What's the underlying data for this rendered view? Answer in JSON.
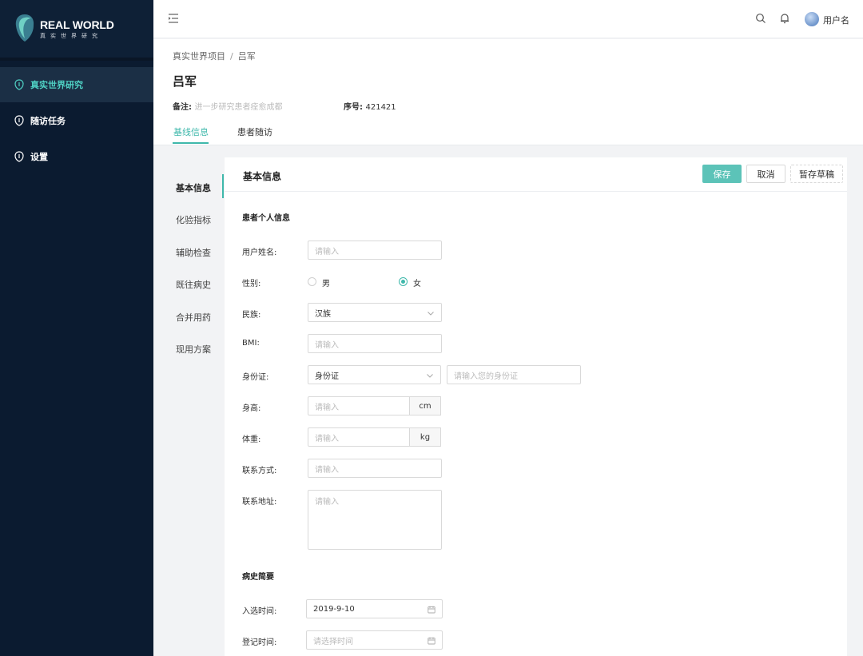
{
  "brand": {
    "title": "REAL WORLD",
    "subtitle": "真实世界研究"
  },
  "sidebar": {
    "items": [
      {
        "label": "真实世界研究",
        "active": true
      },
      {
        "label": "随访任务",
        "active": false
      },
      {
        "label": "设置",
        "active": false
      }
    ]
  },
  "topbar": {
    "username": "用户名"
  },
  "header": {
    "breadcrumb": [
      "真实世界项目",
      "吕军"
    ],
    "breadcrumb_sep": "/",
    "title": "吕军",
    "remark_label": "备注:",
    "remark_value": "进一步研究患者痊愈成都",
    "serial_label": "序号:",
    "serial_value": "421421",
    "tabs": [
      {
        "label": "基线信息",
        "active": true
      },
      {
        "label": "患者随访",
        "active": false
      }
    ]
  },
  "section_menu": [
    "基本信息",
    "化验指标",
    "辅助检查",
    "既往病史",
    "合并用药",
    "现用方案"
  ],
  "card": {
    "title": "基本信息",
    "buttons": {
      "save": "保存",
      "cancel": "取消",
      "draft": "暂存草稿"
    },
    "group_personal": "患者个人信息",
    "group_history": "病史简要",
    "fields": {
      "name": {
        "label": "用户姓名:",
        "placeholder": "请输入"
      },
      "gender": {
        "label": "性别:",
        "options": [
          "男",
          "女"
        ],
        "selected": "女"
      },
      "ethnicity": {
        "label": "民族:",
        "value": "汉族"
      },
      "bmi": {
        "label": "BMI:",
        "placeholder": "请输入"
      },
      "id": {
        "label": "身份证:",
        "type_value": "身份证",
        "placeholder": "请输入您的身份证"
      },
      "height": {
        "label": "身高:",
        "placeholder": "请输入",
        "unit": "cm"
      },
      "weight": {
        "label": "体重:",
        "placeholder": "请输入",
        "unit": "kg"
      },
      "contact": {
        "label": "联系方式:",
        "placeholder": "请输入"
      },
      "address": {
        "label": "联系地址:",
        "placeholder": "请输入"
      },
      "enroll_date": {
        "label": "入选时间:",
        "value": "2019-9-10"
      },
      "register_date": {
        "label": "登记时间:",
        "placeholder": "请选择时间"
      }
    }
  },
  "colors": {
    "accent": "#3fb8ab",
    "sidebar_bg": "#0b1b30",
    "save_button": "#5cc3b8"
  }
}
